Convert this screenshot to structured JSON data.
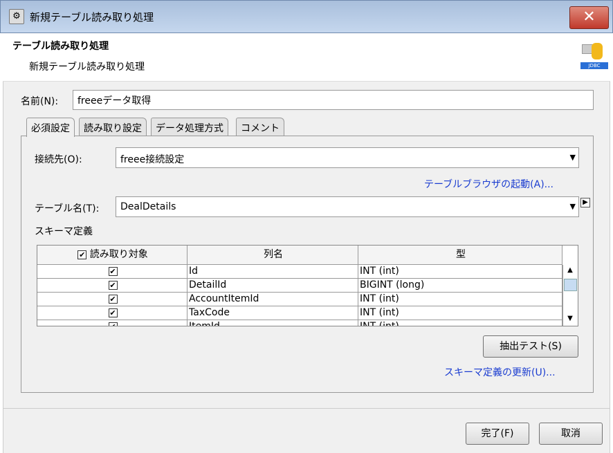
{
  "window": {
    "title": "新規テーブル読み取り処理",
    "close": "✕"
  },
  "header": {
    "title": "テーブル読み取り処理",
    "subtitle": "新規テーブル読み取り処理",
    "logo_text": "JDBC"
  },
  "name": {
    "label": "名前(N):",
    "value": "freeeデータ取得"
  },
  "tabs": [
    {
      "label": "必須設定"
    },
    {
      "label": "読み取り設定"
    },
    {
      "label": "データ処理方式"
    },
    {
      "label": "コメント"
    }
  ],
  "connection": {
    "label": "接続先(O):",
    "value": "freee接続設定"
  },
  "browser_link": "テーブルブラウザの起動(A)...",
  "table_name": {
    "label": "テーブル名(T):",
    "value": "DealDetails"
  },
  "schema": {
    "label": "スキーマ定義",
    "columns": [
      "読み取り対象",
      "列名",
      "型"
    ],
    "rows": [
      {
        "checked": true,
        "name": "Id",
        "type": "INT (int)"
      },
      {
        "checked": true,
        "name": "DetailId",
        "type": "BIGINT (long)"
      },
      {
        "checked": true,
        "name": "AccountItemId",
        "type": "INT (int)"
      },
      {
        "checked": true,
        "name": "TaxCode",
        "type": "INT (int)"
      },
      {
        "checked": true,
        "name": "ItemId",
        "type": "INT (int)"
      }
    ]
  },
  "extract_test": "抽出テスト(S)",
  "update_link": "スキーマ定義の更新(U)...",
  "buttons": {
    "finish": "完了(F)",
    "cancel": "取消"
  }
}
